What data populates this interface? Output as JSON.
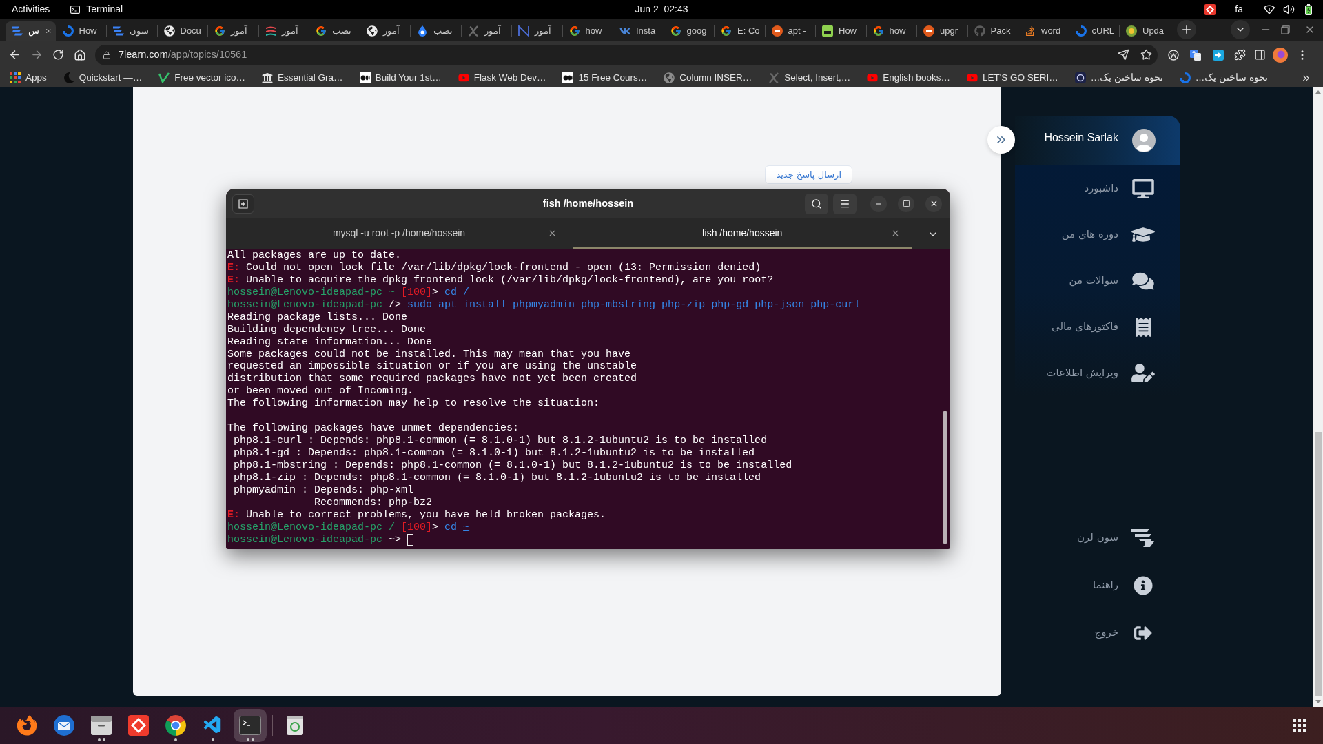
{
  "top_bar": {
    "activities": "Activities",
    "app_name": "Terminal",
    "clock": "Jun 2  02:43",
    "keyboard_layout": "fa"
  },
  "browser": {
    "tabs": [
      {
        "title": "س",
        "selected": true
      },
      {
        "title": "How",
        "selected": false
      },
      {
        "title": "سون",
        "selected": false
      },
      {
        "title": "Docu",
        "selected": false
      },
      {
        "title": "آموز",
        "selected": false
      },
      {
        "title": "آموز",
        "selected": false
      },
      {
        "title": "نصب",
        "selected": false
      },
      {
        "title": "آموز",
        "selected": false
      },
      {
        "title": "نصب",
        "selected": false
      },
      {
        "title": "آموز",
        "selected": false
      },
      {
        "title": "آموز",
        "selected": false
      },
      {
        "title": "how",
        "selected": false
      },
      {
        "title": "Insta",
        "selected": false
      },
      {
        "title": "goog",
        "selected": false
      },
      {
        "title": "E: Co",
        "selected": false
      },
      {
        "title": "apt -",
        "selected": false
      },
      {
        "title": "How",
        "selected": false
      },
      {
        "title": "how",
        "selected": false
      },
      {
        "title": "upgr",
        "selected": false
      },
      {
        "title": "Pack",
        "selected": false
      },
      {
        "title": "word",
        "selected": false
      },
      {
        "title": "cURL",
        "selected": false
      },
      {
        "title": "Upda",
        "selected": false
      }
    ],
    "address": {
      "domain": "7learn.com",
      "path": "/app/topics/10561"
    },
    "bookmarks": [
      "Apps",
      "Quickstart —…",
      "Free vector ico…",
      "Essential Gra…",
      "Build Your 1st…",
      "Flask Web Dev…",
      "15 Free Cours…",
      "Column INSER…",
      "Select, Insert,…",
      "English books…",
      "LET'S GO SERI…",
      "نحوه ساختن یک…",
      "نحوه ساختن یک…"
    ]
  },
  "page": {
    "reply_button": "ارسال پاسخ جدید",
    "sidebar": {
      "user_name": "Hossein Sarlak",
      "menu": [
        "داشبورد",
        "دوره های من",
        "سوالات من",
        "فاکتورهای مالی",
        "ویرایش اطلاعات"
      ],
      "footer_menu": [
        "سون لرن",
        "راهنما",
        "خروج"
      ]
    }
  },
  "terminal": {
    "title": "fish /home/hossein",
    "tabs": [
      {
        "title": "mysql -u root -p /home/hossein",
        "selected": false
      },
      {
        "title": "fish /home/hossein",
        "selected": true
      }
    ],
    "lines": [
      {
        "kind": "output",
        "segments": [
          {
            "kind": "text",
            "text": "All packages are up to date."
          }
        ]
      },
      {
        "kind": "output",
        "segments": [
          {
            "kind": "error",
            "text": "E:"
          },
          {
            "kind": "text",
            "text": " Could not open lock file /var/lib/dpkg/lock-frontend - open (13: Permission denied)"
          }
        ]
      },
      {
        "kind": "output",
        "segments": [
          {
            "kind": "error",
            "text": "E:"
          },
          {
            "kind": "text",
            "text": " Unable to acquire the dpkg frontend lock (/var/lib/dpkg/lock-frontend), are you root?"
          }
        ]
      },
      {
        "kind": "prompt",
        "cursor": false,
        "segments": [
          {
            "kind": "user",
            "text": "hossein@Lenovo-ideapad-pc"
          },
          {
            "kind": "cwd",
            "text": " ~ "
          },
          {
            "kind": "status",
            "text": "[100]"
          },
          {
            "kind": "text",
            "text": "> "
          },
          {
            "kind": "command",
            "text": "cd "
          },
          {
            "kind": "path",
            "text": "/"
          }
        ]
      },
      {
        "kind": "prompt",
        "cursor": false,
        "segments": [
          {
            "kind": "user",
            "text": "hossein@Lenovo-ideapad-pc"
          },
          {
            "kind": "text",
            "text": " /> "
          },
          {
            "kind": "command",
            "text": "sudo apt install phpmyadmin php-mbstring php-zip php-gd php-json php-curl"
          }
        ]
      },
      {
        "kind": "output",
        "segments": [
          {
            "kind": "text",
            "text": "Reading package lists... Done"
          }
        ]
      },
      {
        "kind": "output",
        "segments": [
          {
            "kind": "text",
            "text": "Building dependency tree... Done"
          }
        ]
      },
      {
        "kind": "output",
        "segments": [
          {
            "kind": "text",
            "text": "Reading state information... Done"
          }
        ]
      },
      {
        "kind": "output",
        "segments": [
          {
            "kind": "text",
            "text": "Some packages could not be installed. This may mean that you have"
          }
        ]
      },
      {
        "kind": "output",
        "segments": [
          {
            "kind": "text",
            "text": "requested an impossible situation or if you are using the unstable"
          }
        ]
      },
      {
        "kind": "output",
        "segments": [
          {
            "kind": "text",
            "text": "distribution that some required packages have not yet been created"
          }
        ]
      },
      {
        "kind": "output",
        "segments": [
          {
            "kind": "text",
            "text": "or been moved out of Incoming."
          }
        ]
      },
      {
        "kind": "output",
        "segments": [
          {
            "kind": "text",
            "text": "The following information may help to resolve the situation:"
          }
        ]
      },
      {
        "kind": "blank"
      },
      {
        "kind": "output",
        "segments": [
          {
            "kind": "text",
            "text": "The following packages have unmet dependencies:"
          }
        ]
      },
      {
        "kind": "output",
        "segments": [
          {
            "kind": "text",
            "text": " php8.1-curl : Depends: php8.1-common (= 8.1.0-1) but 8.1.2-1ubuntu2 is to be installed"
          }
        ]
      },
      {
        "kind": "output",
        "segments": [
          {
            "kind": "text",
            "text": " php8.1-gd : Depends: php8.1-common (= 8.1.0-1) but 8.1.2-1ubuntu2 is to be installed"
          }
        ]
      },
      {
        "kind": "output",
        "segments": [
          {
            "kind": "text",
            "text": " php8.1-mbstring : Depends: php8.1-common (= 8.1.0-1) but 8.1.2-1ubuntu2 is to be installed"
          }
        ]
      },
      {
        "kind": "output",
        "segments": [
          {
            "kind": "text",
            "text": " php8.1-zip : Depends: php8.1-common (= 8.1.0-1) but 8.1.2-1ubuntu2 is to be installed"
          }
        ]
      },
      {
        "kind": "output",
        "segments": [
          {
            "kind": "text",
            "text": " phpmyadmin : Depends: php-xml"
          }
        ]
      },
      {
        "kind": "output",
        "segments": [
          {
            "kind": "text",
            "text": "              Recommends: php-bz2"
          }
        ]
      },
      {
        "kind": "output",
        "segments": [
          {
            "kind": "error",
            "text": "E:"
          },
          {
            "kind": "text",
            "text": " Unable to correct problems, you have held broken packages."
          }
        ]
      },
      {
        "kind": "prompt",
        "cursor": false,
        "segments": [
          {
            "kind": "user",
            "text": "hossein@Lenovo-ideapad-pc"
          },
          {
            "kind": "cwd",
            "text": " / "
          },
          {
            "kind": "status",
            "text": "[100]"
          },
          {
            "kind": "text",
            "text": "> "
          },
          {
            "kind": "command",
            "text": "cd "
          },
          {
            "kind": "path",
            "text": "~"
          }
        ]
      },
      {
        "kind": "prompt",
        "cursor": true,
        "segments": [
          {
            "kind": "user",
            "text": "hossein@Lenovo-ideapad-pc"
          },
          {
            "kind": "text",
            "text": " ~> "
          }
        ]
      }
    ]
  },
  "dock": [
    {
      "running": false,
      "multiple_windows": false,
      "selected": false
    },
    {
      "running": false,
      "multiple_windows": false,
      "selected": false
    },
    {
      "running": true,
      "multiple_windows": true,
      "selected": false
    },
    {
      "running": false,
      "multiple_windows": false,
      "selected": false
    },
    {
      "running": true,
      "multiple_windows": false,
      "selected": false
    },
    {
      "running": true,
      "multiple_windows": false,
      "selected": false
    },
    {
      "running": true,
      "multiple_windows": true,
      "selected": true
    },
    {
      "running": false,
      "multiple_windows": false,
      "selected": false
    }
  ]
}
